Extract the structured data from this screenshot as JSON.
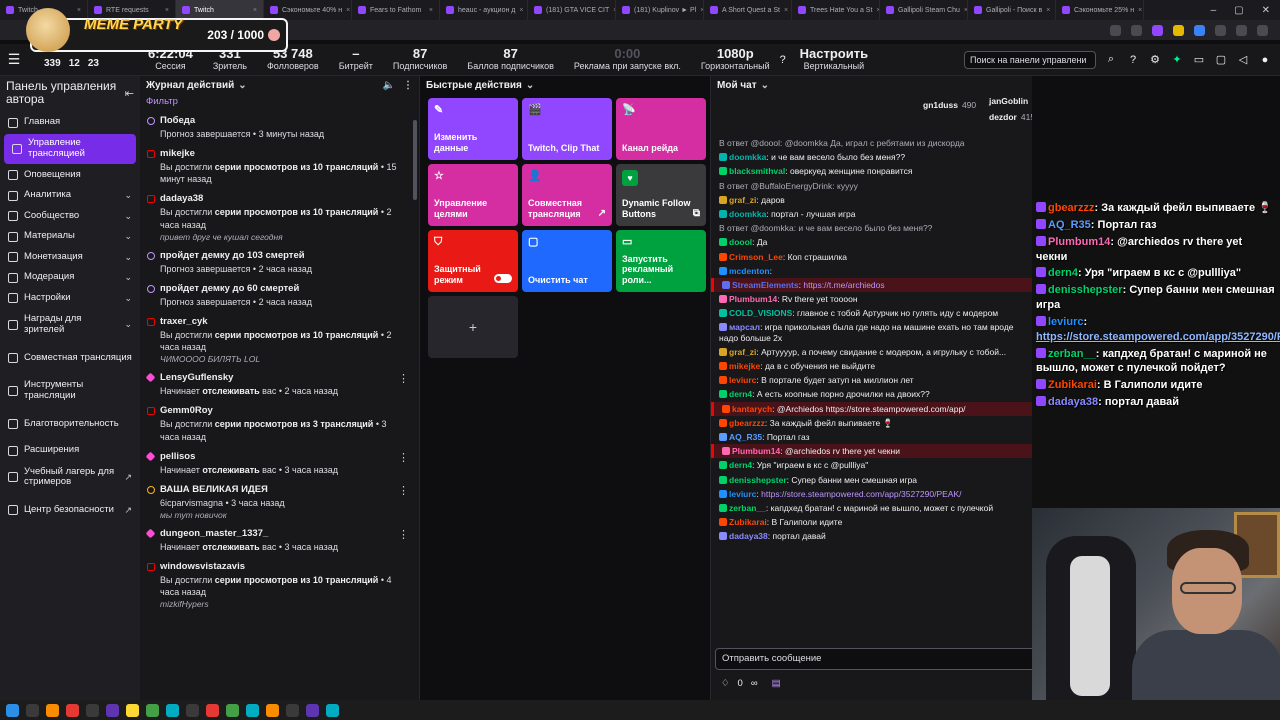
{
  "browser": {
    "tabs": [
      {
        "label": "Twitch",
        "active": false
      },
      {
        "label": "RTE requests",
        "active": false
      },
      {
        "label": "Twitch",
        "active": true
      },
      {
        "label": "Сэкономьте 40% н",
        "active": false
      },
      {
        "label": "Fears to Fathom",
        "active": false
      },
      {
        "label": "heauc - аукцион д",
        "active": false
      },
      {
        "label": "(181) GTA VICE CIT",
        "active": false
      },
      {
        "label": "(181) Kuplinov ► Pl",
        "active": false
      },
      {
        "label": "A Short Quest a St",
        "active": false
      },
      {
        "label": "Trees Hate You a St",
        "active": false
      },
      {
        "label": "Gallipoli Steam Chu",
        "active": false
      },
      {
        "label": "Gallipoli - Поиск в",
        "active": false
      },
      {
        "label": "Сэкономьте 25% н",
        "active": false
      }
    ]
  },
  "overlay": {
    "title": "MEME PARTY",
    "counter": "203 / 1000"
  },
  "stats": [
    {
      "value": "339",
      "label": "Зрители"
    },
    {
      "value": "12",
      "label": ""
    },
    {
      "value": "23",
      "label": ""
    },
    {
      "value": "6:22:04",
      "label": "Сессия"
    },
    {
      "value": "331",
      "label": "Зритель"
    },
    {
      "value": "53 748",
      "label": "Фолловеров"
    },
    {
      "value": "–",
      "label": "Битрейт"
    },
    {
      "value": "87",
      "label": "Подписчиков"
    },
    {
      "value": "87",
      "label": "Баллов подписчиков"
    },
    {
      "value": "0:00",
      "label": "Реклама при запуске вкл."
    },
    {
      "value": "1080p",
      "label": "Горизонтальный"
    },
    {
      "value": "Настроить",
      "label": "Вертикальный"
    }
  ],
  "header_search": {
    "placeholder": "Поиск на панели управлени"
  },
  "nav": {
    "title": "Панель управления автора",
    "items": [
      {
        "label": "Главная",
        "chevron": "",
        "active": false
      },
      {
        "label": "Управление трансляцией",
        "chevron": "",
        "active": true
      },
      {
        "label": "Оповещения",
        "chevron": "",
        "active": false
      },
      {
        "label": "Аналитика",
        "chevron": "⌄",
        "active": false
      },
      {
        "label": "Сообщество",
        "chevron": "⌄",
        "active": false
      },
      {
        "label": "Материалы",
        "chevron": "⌄",
        "active": false
      },
      {
        "label": "Монетизация",
        "chevron": "⌄",
        "active": false
      },
      {
        "label": "Модерация",
        "chevron": "⌄",
        "active": false
      },
      {
        "label": "Настройки",
        "chevron": "⌄",
        "active": false
      },
      {
        "label": "Награды для зрителей",
        "chevron": "⌄",
        "active": false
      },
      {
        "label": "Совместная трансляция",
        "chevron": "",
        "active": false
      },
      {
        "label": "Инструменты трансляции",
        "chevron": "",
        "active": false
      },
      {
        "label": "Благотворительность",
        "chevron": "",
        "active": false
      },
      {
        "label": "Расширения",
        "chevron": "",
        "active": false
      },
      {
        "label": "Учебный лагерь для стримеров",
        "chevron": "↗",
        "active": false
      },
      {
        "label": "Центр безопасности",
        "chevron": "↗",
        "active": false
      }
    ]
  },
  "journal": {
    "title": "Журнал действий",
    "filter": "Фильтр",
    "events": [
      {
        "name": "Победа",
        "pre": "",
        "bold": "",
        "desc": "Прогноз завершается • 3 минуты назад",
        "msg": "",
        "icon": "pred"
      },
      {
        "name": "mikejke",
        "pre": "Вы достигли ",
        "bold": "серии просмотров из 10 трансляций",
        "desc": " • 15 минут назад",
        "msg": "",
        "icon": "red"
      },
      {
        "name": "dadaya38",
        "pre": "Вы достигли ",
        "bold": "серии просмотров из 10 трансляций",
        "desc": " • 2 часа назад",
        "msg": "привет друг че кушал сегодня",
        "icon": "red"
      },
      {
        "name": "пройдет демку до 103 смертей",
        "pre": "",
        "bold": "",
        "desc": "Прогноз завершается • 2 часа назад",
        "msg": "",
        "icon": "pred"
      },
      {
        "name": "пройдет демку до 60 смертей",
        "pre": "",
        "bold": "",
        "desc": "Прогноз завершается • 2 часа назад",
        "msg": "",
        "icon": "pred"
      },
      {
        "name": "traxer_cyk",
        "pre": "Вы достигли ",
        "bold": "серии просмотров из 10 трансляций",
        "desc": " • 2 часа назад",
        "msg": "ЧИМОООО БИЛЯТЬ LOL",
        "icon": "red"
      },
      {
        "name": "LensyGuflensky",
        "pre": "Начинает ",
        "bold": "отслеживать",
        "desc": " вас • 2 часа назад",
        "msg": "",
        "icon": "heart"
      },
      {
        "name": "Gemm0Roy",
        "pre": "Вы достигли ",
        "bold": "серии просмотров из 3 трансляций",
        "desc": " • 3 часа назад",
        "msg": "",
        "icon": "red"
      },
      {
        "name": "pellisos",
        "pre": "Начинает ",
        "bold": "отслеживать",
        "desc": " вас • 3 часа назад",
        "msg": "",
        "icon": "heart"
      },
      {
        "name": "ВАША ВЕЛИКАЯ ИДЕЯ",
        "pre": "",
        "bold": "",
        "desc": "6icparvismagna • 3 часа назад",
        "msg": "мы тут новичок",
        "icon": "bulb"
      },
      {
        "name": "dungeon_master_1337_",
        "pre": "Начинает ",
        "bold": "отслеживать",
        "desc": " вас • 3 часа назад",
        "msg": "",
        "icon": "heart"
      },
      {
        "name": "windowsvistazavis",
        "pre": "Вы достигли ",
        "bold": "серии просмотров из 10 трансляций",
        "desc": " • 4 часа назад",
        "msg": "mizkifHypers",
        "icon": "red"
      }
    ]
  },
  "quick": {
    "title": "Быстрые действия",
    "actions": [
      {
        "label": "Изменить данные",
        "color": "purple",
        "icon": "✎",
        "extra": ""
      },
      {
        "label": "Twitch, Clip That",
        "color": "purple",
        "icon": "🎬",
        "extra": ""
      },
      {
        "label": "Канал рейда",
        "color": "magenta",
        "icon": "📡",
        "extra": ""
      },
      {
        "label": "Управление целями",
        "color": "magenta",
        "icon": "☆",
        "extra": ""
      },
      {
        "label": "Совместная трансляция",
        "color": "magenta",
        "icon": "👤",
        "extra": "↗"
      },
      {
        "label": "Dynamic Follow Buttons",
        "color": "grey",
        "icon": "♥",
        "extra": "⧉"
      },
      {
        "label": "Защитный режим",
        "color": "red",
        "icon": "⛉",
        "extra": "toggle"
      },
      {
        "label": "Очистить чат",
        "color": "blue",
        "icon": "▢",
        "extra": ""
      },
      {
        "label": "Запустить рекламный роли...",
        "color": "green",
        "icon": "▭",
        "extra": ""
      }
    ],
    "add_label": "+"
  },
  "chat": {
    "title": "Мой чат",
    "top": [
      {
        "name": "gn1duss",
        "count": "490"
      },
      {
        "name": "janGoblin",
        "count": "452"
      },
      {
        "name": "dezdor",
        "count": "415"
      }
    ],
    "lines": [
      {
        "reply": "В ответ @doool: @doomkka Да, играл с ребятами из дискорда",
        "user": "",
        "color": "",
        "text": "",
        "hl": ""
      },
      {
        "reply": "",
        "user": "doomkka",
        "color": "#00b5ad",
        "text": "и че вам весело было без меня??",
        "hl": ""
      },
      {
        "reply": "",
        "user": "blacksmithval",
        "color": "#00d26a",
        "text": "оверкуед женщине понравится",
        "hl": ""
      },
      {
        "reply": "В ответ @BuffaloEnergyDrink: куууу",
        "user": "",
        "color": "",
        "text": "",
        "hl": ""
      },
      {
        "reply": "",
        "user": "graf_zi",
        "color": "#daa520",
        "text": "даров",
        "hl": ""
      },
      {
        "reply": "",
        "user": "doomkka",
        "color": "#00b5ad",
        "text": "портал - лучшая игра",
        "hl": ""
      },
      {
        "reply": "В ответ @doomkka: и че вам весело было без меня??",
        "user": "",
        "color": "",
        "text": "",
        "hl": ""
      },
      {
        "reply": "",
        "user": "doool",
        "color": "#00d26a",
        "text": "Да",
        "hl": ""
      },
      {
        "reply": "",
        "user": "Crimson_Lee",
        "color": "#ff4500",
        "text": "Коп страшилка",
        "hl": ""
      },
      {
        "reply": "",
        "user": "mcdenton",
        "color": "#1e90ff",
        "text": "",
        "hl": ""
      },
      {
        "reply": "",
        "user": "StreamElements",
        "color": "#5b6ff0",
        "text": "https://t.me/archiedos",
        "hl": "red"
      },
      {
        "reply": "",
        "user": "Plumbum14",
        "color": "#ff69b4",
        "text": "Rv there yet тоооон",
        "hl": ""
      },
      {
        "reply": "",
        "user": "COLD_VISIONS",
        "color": "#00c2a0",
        "text": "главное с тобой Артурчик но гулять иду с модером",
        "hl": ""
      },
      {
        "reply": "",
        "user": "марсал",
        "color": "#8a8aff",
        "text": "игра прикольная была где надо на машине ехать но там вроде надо больше 2х",
        "hl": ""
      },
      {
        "reply": "",
        "user": "graf_zi",
        "color": "#daa520",
        "text": "Артуууур, а почему свидание с модером, а игрульку с тобой...",
        "hl": ""
      },
      {
        "reply": "",
        "user": "mikejke",
        "color": "#ff4500",
        "text": "да в с обучения не выйдите",
        "hl": ""
      },
      {
        "reply": "",
        "user": "leviurc",
        "color": "#ff4500",
        "text": "В портале будет затуп на миллион лет",
        "hl": ""
      },
      {
        "reply": "",
        "user": "dern4",
        "color": "#00d26a",
        "text": "А есть коопные порно дрочилки на двоих??",
        "hl": ""
      },
      {
        "reply": "",
        "user": "kantarych",
        "color": "#ff4500",
        "text": "@Archiedos https://store.steampowered.com/app/",
        "hl": "red"
      },
      {
        "reply": "",
        "user": "gbearzzz",
        "color": "#ff4500",
        "text": "За каждый фейл выпиваете 🍷",
        "hl": ""
      },
      {
        "reply": "",
        "user": "AQ_R35",
        "color": "#5b9bff",
        "text": "Портал газ",
        "hl": ""
      },
      {
        "reply": "",
        "user": "Plumbum14",
        "color": "#ff69b4",
        "text": "@archiedos rv there yet чекни",
        "hl": "red"
      },
      {
        "reply": "",
        "user": "dern4",
        "color": "#00d26a",
        "text": "Уря \"играем в кс с @pullliya\"",
        "hl": ""
      },
      {
        "reply": "",
        "user": "denisshepster",
        "color": "#00d26a",
        "text": "Супер банни мен смешная игра",
        "hl": ""
      },
      {
        "reply": "",
        "user": "leviurc",
        "color": "#1e90ff",
        "text": "https://store.steampowered.com/app/3527290/PEAK/",
        "hl": ""
      },
      {
        "reply": "",
        "user": "zerban__",
        "color": "#00d26a",
        "text": "капдхед братан! с мариной не вышло, может с пулечкой",
        "hl": ""
      },
      {
        "reply": "",
        "user": "Zubikarai",
        "color": "#ff4500",
        "text": "В Галиполи идите",
        "hl": ""
      },
      {
        "reply": "",
        "user": "dadaya38",
        "color": "#8a8aff",
        "text": "портал давай",
        "hl": ""
      }
    ],
    "input_placeholder": "Отправить сообщение",
    "points": "0"
  },
  "overlay_chat": [
    {
      "user": "gbearzzz",
      "text": "За каждый фейл выпиваете 🍷",
      "color": "#ff4500"
    },
    {
      "user": "AQ_R35",
      "text": "Портал газ",
      "color": "#5b9bff"
    },
    {
      "user": "Plumbum14",
      "text": "@archiedos rv there yet чекни",
      "color": "#ff69b4"
    },
    {
      "user": "dern4",
      "text": "Уря \"играем в кс с @pullliya\"",
      "color": "#00d26a"
    },
    {
      "user": "denisshepster",
      "text": "Супер банни мен смешная игра",
      "color": "#00d26a"
    },
    {
      "user": "leviurc",
      "text": "https://store.steampowered.com/app/3527290/PEAK/",
      "color": "#1e90ff"
    },
    {
      "user": "zerban__",
      "text": "капдхед братан! с мариной не вышло, может с пулечкой пойдет?",
      "color": "#00d26a"
    },
    {
      "user": "Zubikarai",
      "text": "В Галиполи идите",
      "color": "#ff4500"
    },
    {
      "user": "dadaya38",
      "text": "портал давай",
      "color": "#8a8aff"
    }
  ]
}
